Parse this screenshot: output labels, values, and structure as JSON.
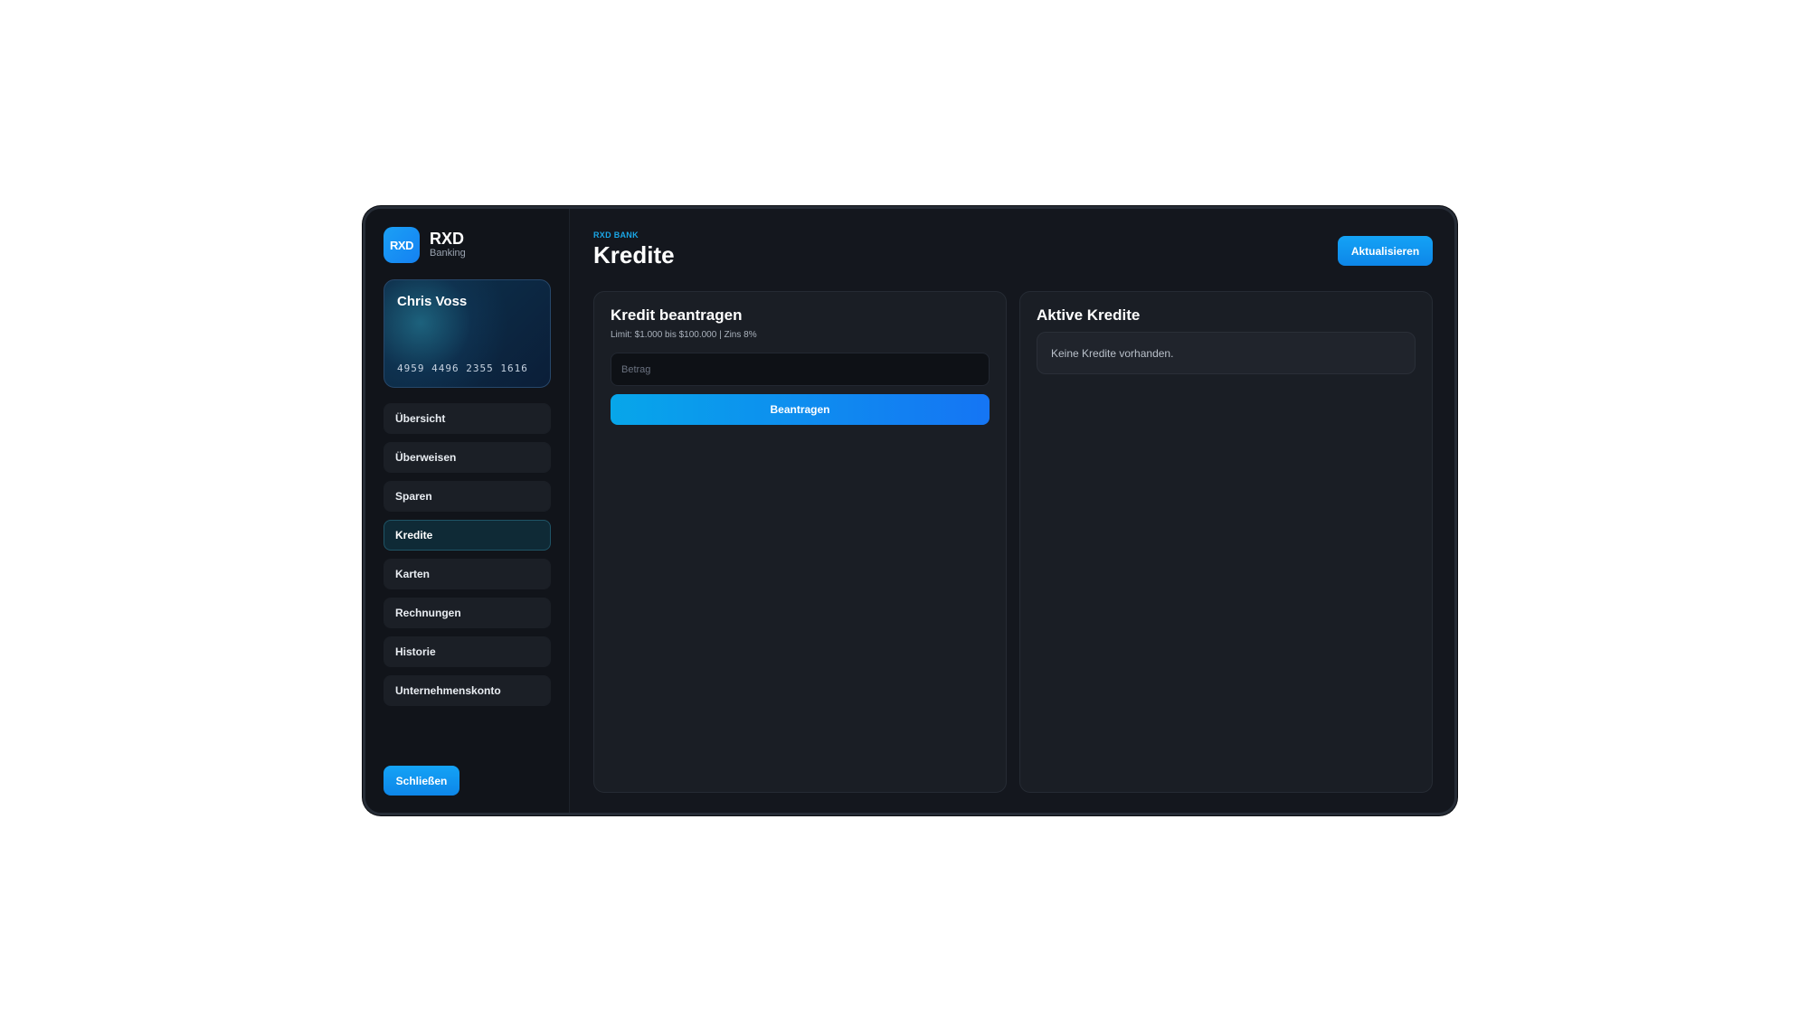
{
  "brand": {
    "logo": "RXD",
    "name": "RXD",
    "sub": "Banking"
  },
  "card": {
    "holder": "Chris Voss",
    "number": "4959 4496 2355 1616"
  },
  "nav": {
    "items": [
      {
        "label": "Übersicht"
      },
      {
        "label": "Überweisen"
      },
      {
        "label": "Sparen"
      },
      {
        "label": "Kredite",
        "active": true
      },
      {
        "label": "Karten"
      },
      {
        "label": "Rechnungen"
      },
      {
        "label": "Historie"
      },
      {
        "label": "Unternehmenskonto"
      }
    ]
  },
  "sidebar": {
    "close_label": "Schließen"
  },
  "header": {
    "eyebrow": "RXD BANK",
    "title": "Kredite",
    "refresh_label": "Aktualisieren"
  },
  "apply_panel": {
    "title": "Kredit beantragen",
    "hint": "Limit: $1.000 bis $100.000 | Zins 8%",
    "amount_value": "",
    "amount_placeholder": "Betrag",
    "submit_label": "Beantragen"
  },
  "active_panel": {
    "title": "Aktive Kredite",
    "empty_text": "Keine Kredite vorhanden."
  },
  "colors": {
    "accent": "#1481f2",
    "eyebrow": "#1aa6e6",
    "background": "#14171e"
  }
}
